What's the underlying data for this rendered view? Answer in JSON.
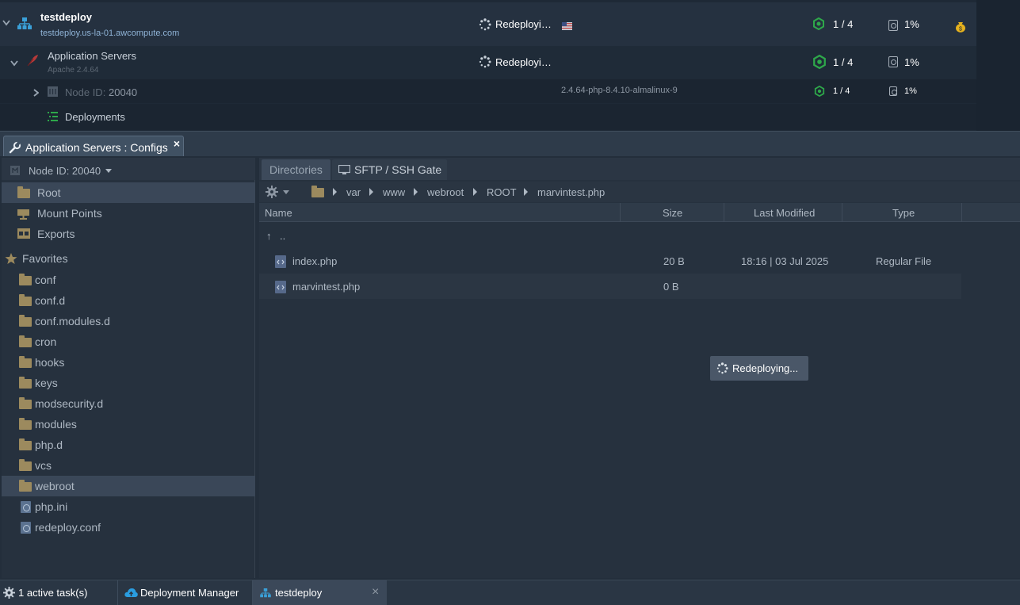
{
  "env": {
    "name": "testdeploy",
    "domain": "testdeploy.us-la-01.awcompute.com",
    "status": "Redeployi…",
    "cloudlets": "1 / 4",
    "disk": "1%"
  },
  "app_servers": {
    "title": "Application Servers",
    "subtitle": "Apache 2.4.64",
    "status": "Redeployi…",
    "cloudlets": "1 / 4",
    "disk": "1%"
  },
  "node": {
    "prefix": "Node ID:",
    "id": "20040",
    "tag": "2.4.64-php-8.4.10-almalinux-9",
    "cloudlets": "1 / 4",
    "disk": "1%"
  },
  "deployments_label": "Deployments",
  "config_window": {
    "tab_title": "Application Servers : Configs",
    "close": "×",
    "node_selector": "Node ID: 20040",
    "tree_top": [
      {
        "label": "Root",
        "icon": "folder-icon",
        "selected": true
      },
      {
        "label": "Mount Points",
        "icon": "mount-icon",
        "selected": false
      },
      {
        "label": "Exports",
        "icon": "exports-icon",
        "selected": false
      }
    ],
    "favorites_label": "Favorites",
    "favorites": [
      {
        "label": "conf",
        "type": "folder"
      },
      {
        "label": "conf.d",
        "type": "folder"
      },
      {
        "label": "conf.modules.d",
        "type": "folder"
      },
      {
        "label": "cron",
        "type": "folder"
      },
      {
        "label": "hooks",
        "type": "folder"
      },
      {
        "label": "keys",
        "type": "folder"
      },
      {
        "label": "modsecurity.d",
        "type": "folder"
      },
      {
        "label": "modules",
        "type": "folder"
      },
      {
        "label": "php.d",
        "type": "folder"
      },
      {
        "label": "vcs",
        "type": "folder"
      },
      {
        "label": "webroot",
        "type": "folder",
        "selected": true
      },
      {
        "label": "php.ini",
        "type": "file"
      },
      {
        "label": "redeploy.conf",
        "type": "file"
      }
    ],
    "tabs": [
      {
        "label": "Directories",
        "active": true
      },
      {
        "label": "SFTP / SSH Gate",
        "active": false
      }
    ],
    "breadcrumb": [
      "var",
      "www",
      "webroot",
      "ROOT",
      "marvintest.php"
    ],
    "columns": [
      "Name",
      "Size",
      "Last Modified",
      "Type"
    ],
    "parent_row": "..",
    "files": [
      {
        "name": "index.php",
        "size": "20 B",
        "modified": "18:16 | 03 Jul 2025",
        "type": "Regular File"
      },
      {
        "name": "marvintest.php",
        "size": "0 B",
        "modified": "",
        "type": ""
      }
    ],
    "loading_message": "Redeploying..."
  },
  "taskbar": {
    "tasks_label": "1 active task(s)",
    "deployment_manager": "Deployment Manager",
    "env_tab": "testdeploy",
    "close": "×"
  }
}
